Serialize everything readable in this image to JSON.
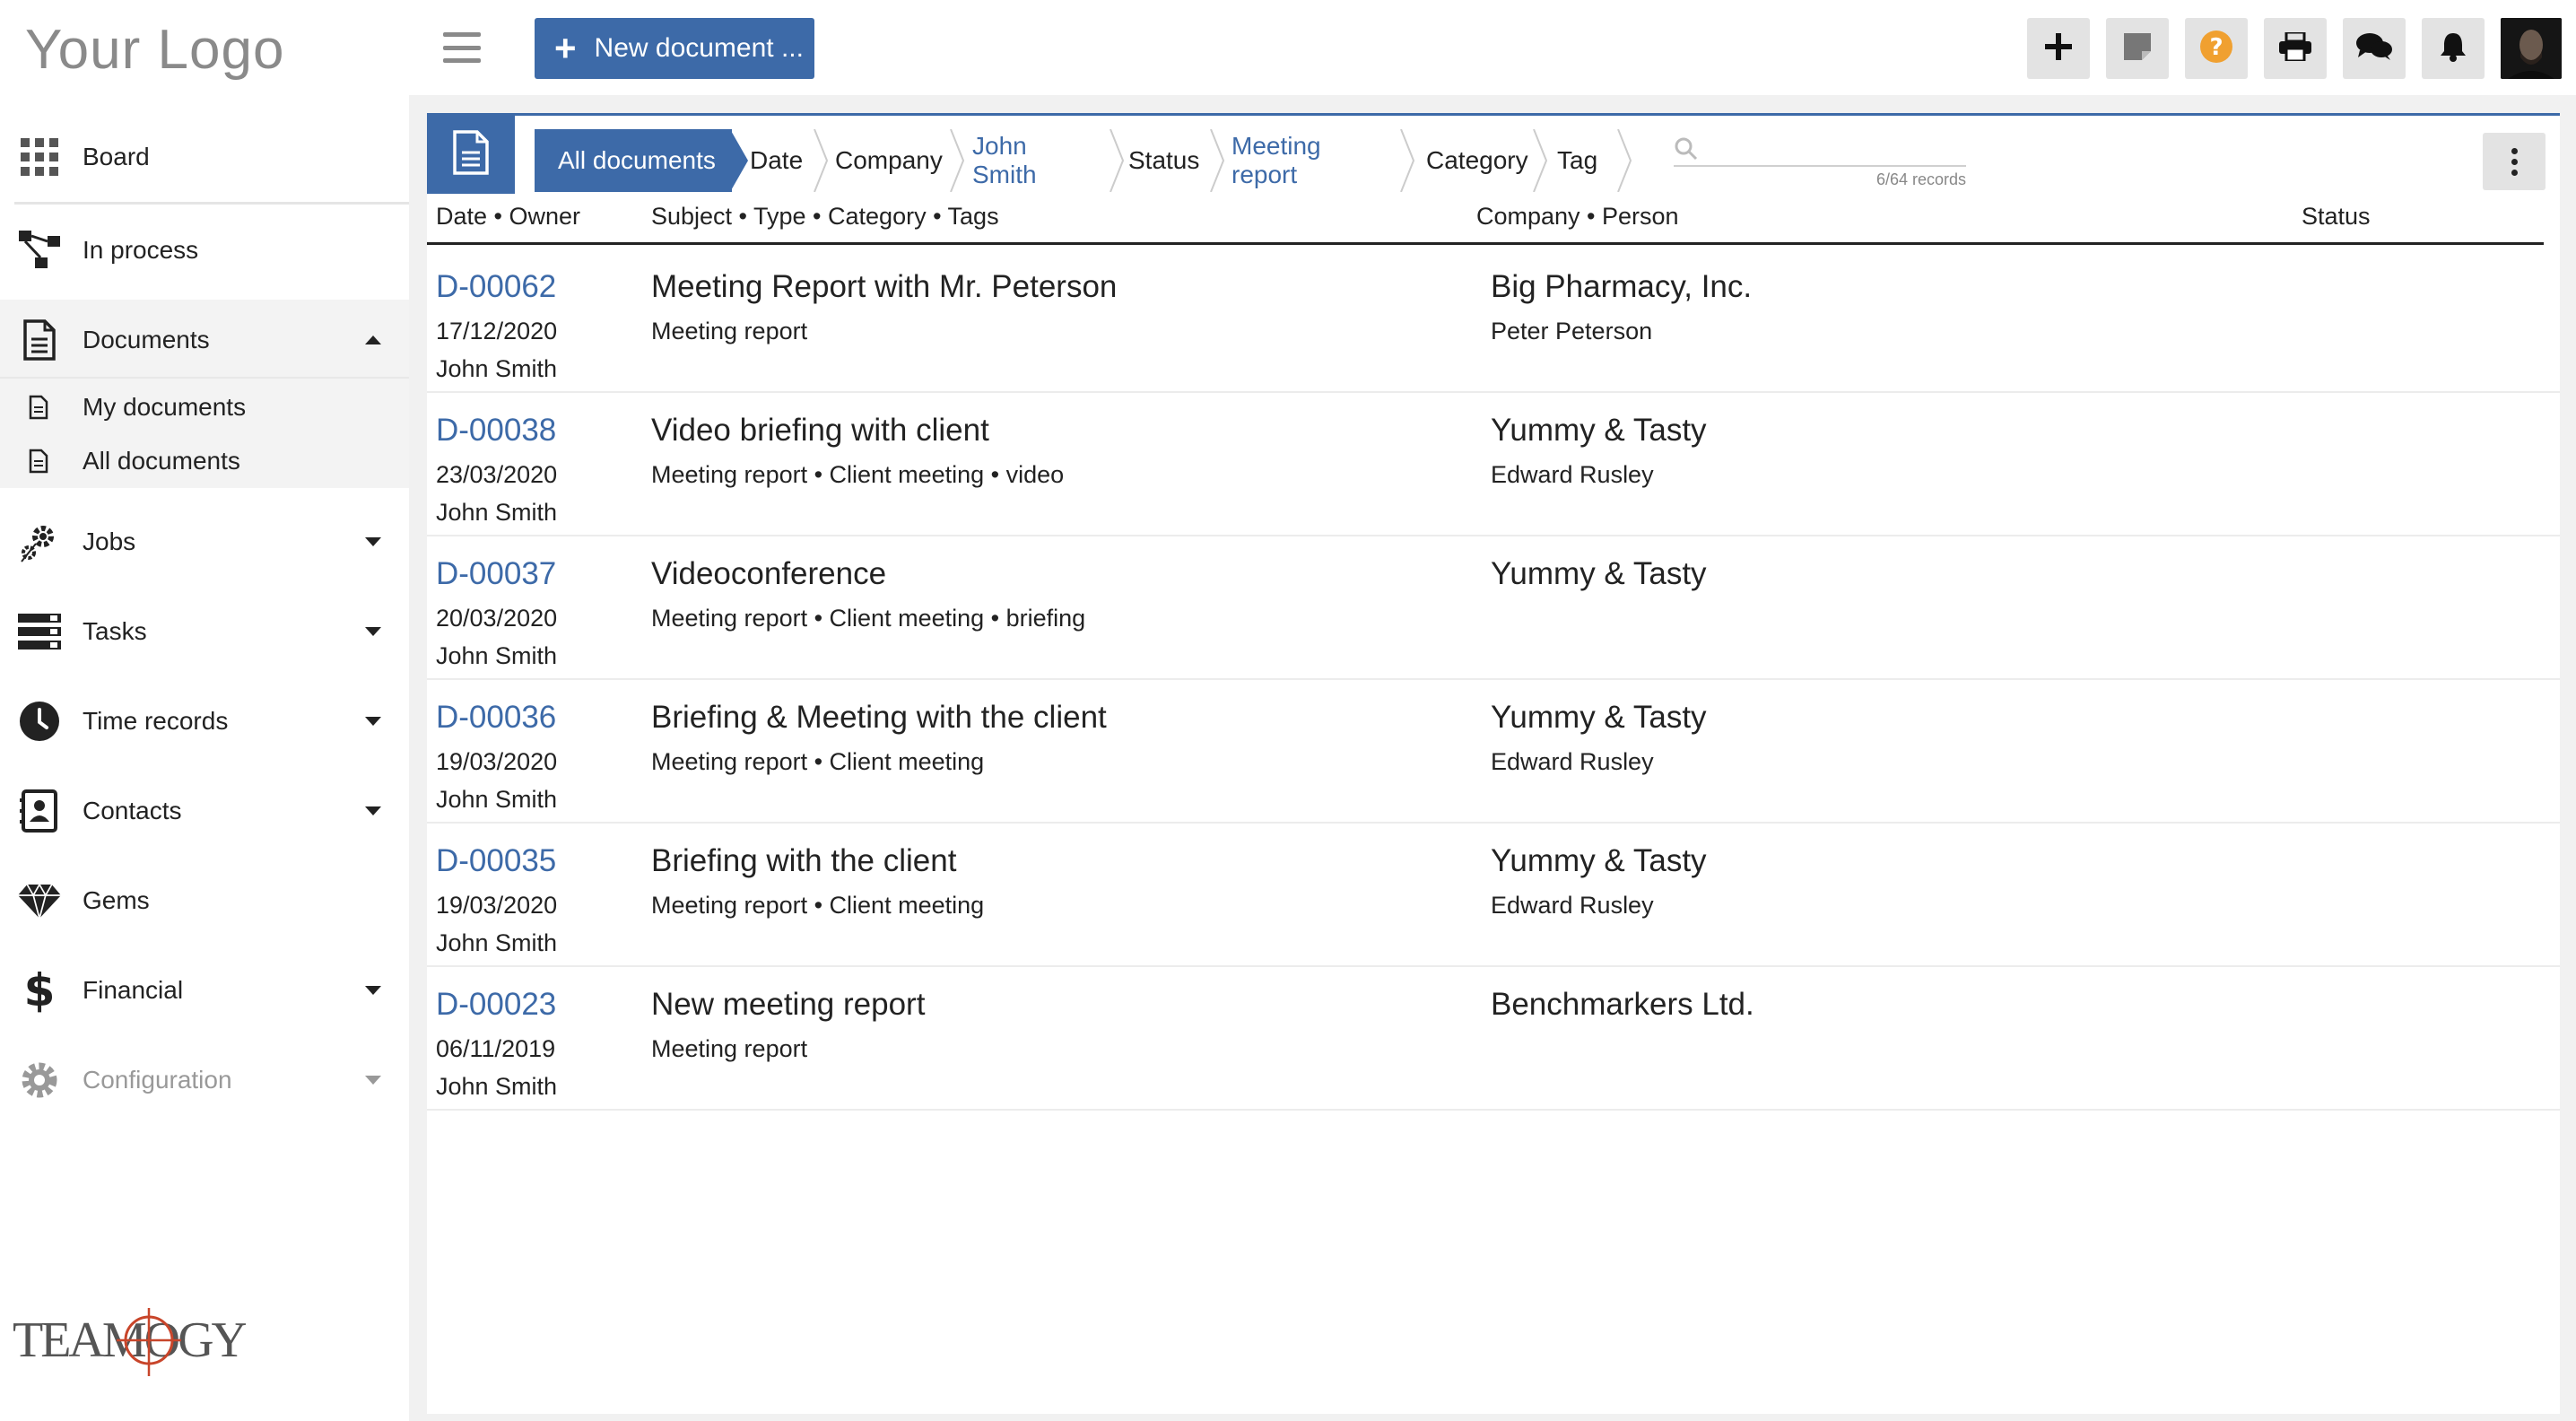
{
  "logo": "Your Logo",
  "sidebar": {
    "items": [
      {
        "label": "Board",
        "icon": "grid-icon"
      },
      {
        "label": "In process",
        "icon": "workflow-icon"
      },
      {
        "label": "Documents",
        "icon": "document-icon",
        "expanded": true
      },
      {
        "label": "Jobs",
        "icon": "gears-icon"
      },
      {
        "label": "Tasks",
        "icon": "tasks-icon"
      },
      {
        "label": "Time records",
        "icon": "clock-icon"
      },
      {
        "label": "Contacts",
        "icon": "contact-book-icon"
      },
      {
        "label": "Gems",
        "icon": "gem-icon"
      },
      {
        "label": "Financial",
        "icon": "dollar-icon"
      },
      {
        "label": "Configuration",
        "icon": "gear-icon"
      }
    ],
    "subitems": [
      {
        "label": "My documents",
        "icon": "file-icon"
      },
      {
        "label": "All documents",
        "icon": "file-icon"
      }
    ],
    "brand": "TEAMOGY"
  },
  "toolbar": {
    "new_document_label": "New document ...",
    "buttons": [
      "plus-icon",
      "note-icon",
      "help-icon",
      "print-icon",
      "chat-icon",
      "bell-icon"
    ],
    "accent_color": "#3d6aa8",
    "help_color": "#f0a030"
  },
  "filters": {
    "crumbs": [
      {
        "label": "All documents",
        "state": "active"
      },
      {
        "label": "Date",
        "state": "normal"
      },
      {
        "label": "Company",
        "state": "normal"
      },
      {
        "label": "John Smith",
        "state": "link"
      },
      {
        "label": "Status",
        "state": "normal"
      },
      {
        "label": "Meeting report",
        "state": "link"
      },
      {
        "label": "Category",
        "state": "normal"
      },
      {
        "label": "Tag",
        "state": "normal"
      }
    ],
    "search_placeholder": "",
    "records": "6/64 records"
  },
  "table": {
    "headers": {
      "date_owner": "Date • Owner",
      "subject": "Subject • Type • Category • Tags",
      "company": "Company • Person",
      "status": "Status"
    },
    "rows": [
      {
        "id": "D-00062",
        "date": "17/12/2020",
        "owner": "John Smith",
        "subject": "Meeting Report with Mr. Peterson",
        "meta": "Meeting report",
        "company": "Big Pharmacy, Inc.",
        "person": "Peter Peterson"
      },
      {
        "id": "D-00038",
        "date": "23/03/2020",
        "owner": "John Smith",
        "subject": "Video briefing with client",
        "meta": "Meeting report • Client meeting • video",
        "company": "Yummy & Tasty",
        "person": "Edward Rusley"
      },
      {
        "id": "D-00037",
        "date": "20/03/2020",
        "owner": "John Smith",
        "subject": "Videoconference",
        "meta": "Meeting report • Client meeting • briefing",
        "company": "Yummy & Tasty",
        "person": ""
      },
      {
        "id": "D-00036",
        "date": "19/03/2020",
        "owner": "John Smith",
        "subject": "Briefing & Meeting with the client",
        "meta": "Meeting report • Client meeting",
        "company": "Yummy & Tasty",
        "person": "Edward Rusley"
      },
      {
        "id": "D-00035",
        "date": "19/03/2020",
        "owner": "John Smith",
        "subject": "Briefing with the client",
        "meta": "Meeting report • Client meeting",
        "company": "Yummy & Tasty",
        "person": "Edward Rusley"
      },
      {
        "id": "D-00023",
        "date": "06/11/2019",
        "owner": "John Smith",
        "subject": "New meeting report",
        "meta": "Meeting report",
        "company": "Benchmarkers Ltd.",
        "person": ""
      }
    ]
  }
}
